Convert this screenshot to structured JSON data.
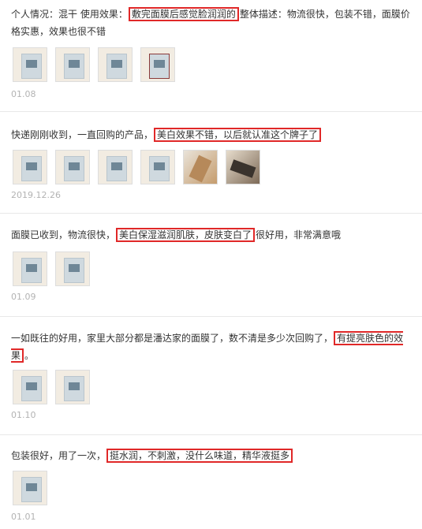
{
  "reviews": [
    {
      "pre": "个人情况：混干 使用效果：",
      "highlight": "敷完面膜后感觉脸润润的",
      "post": "整体描述：物流很快，包装不错，面膜价格实惠，效果也很不错",
      "date": "01.08",
      "images": 4
    },
    {
      "pre": "快递刚刚收到，一直回购的产品，",
      "highlight": "美白效果不错，以后就认准这个牌子了",
      "post": "",
      "date": "2019.12.26",
      "images": 6
    },
    {
      "pre": "面膜已收到，物流很快，",
      "highlight": "美白保湿滋润肌肤，皮肤变白了",
      "post": "很好用，非常满意哦",
      "date": "01.09",
      "images": 2
    },
    {
      "pre": "一如既往的好用，家里大部分都是潘达家的面膜了，数不清是多少次回购了，",
      "highlight": "有提亮肤色的效果",
      "post": "。",
      "date": "01.10",
      "images": 2
    },
    {
      "pre": "包装很好，用了一次，",
      "highlight": "挺水润，不刺激，没什么味道，精华液挺多",
      "post": "",
      "date": "01.01",
      "images": 1
    }
  ]
}
